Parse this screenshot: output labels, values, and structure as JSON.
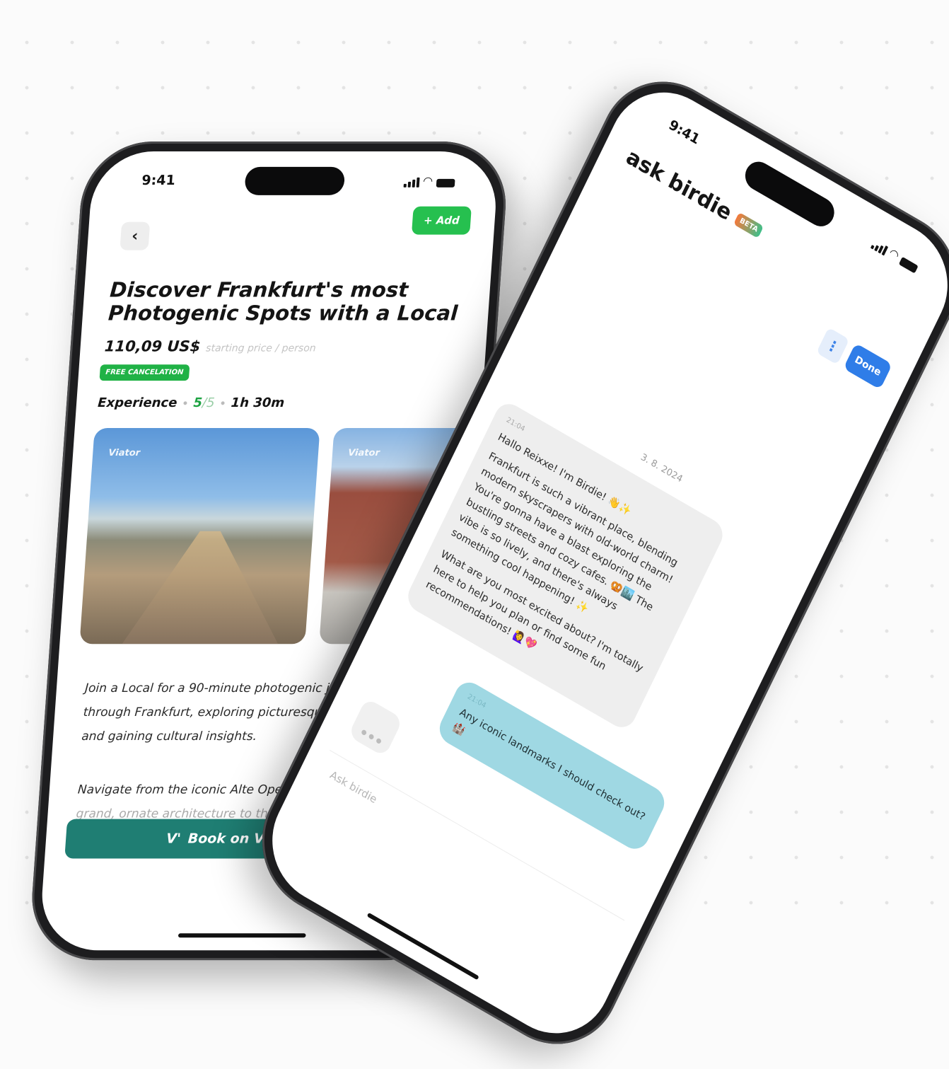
{
  "phone_left": {
    "status": {
      "time": "9:41"
    },
    "header": {
      "back_icon": "chevron-left-icon",
      "add_label": "+ Add"
    },
    "tour": {
      "title": "Discover Frankfurt's most Photogenic Spots with a Local",
      "price": "110,09 US$",
      "price_note": "starting price / person",
      "badge": "FREE CANCELATION",
      "type": "Experience",
      "rating": "5",
      "rating_max": "/5",
      "duration": "1h 30m",
      "photos": [
        {
          "source": "Viator"
        },
        {
          "source": "Viator"
        }
      ],
      "description_1": "Join a Local for a 90-minute photogenic journey through Frankfurt, exploring picturesque highlights and gaining cultural insights.",
      "description_2": "Navigate from the iconic Alte Oper capturing its",
      "description_2_fade": "grand, ornate architecture to the emblematic Iron"
    },
    "cta": {
      "label": "Book on Viator",
      "logo": "V'"
    },
    "colors": {
      "accent_green": "#26c04f",
      "cta_teal": "#1f7e73"
    }
  },
  "phone_right": {
    "status": {
      "time": "9:41"
    },
    "header": {
      "title": "ask birdie",
      "beta_label": "BETA",
      "menu_icon": "more-vertical-icon",
      "done_label": "Done"
    },
    "chat": {
      "date": "3. 8. 2024",
      "incoming": {
        "timestamp": "21:04",
        "greeting": "Hallo Reixxe! I'm Birdie! 👋✨",
        "paragraph_1": "Frankfurt is such a vibrant place, blending modern skyscrapers with old-world charm! You're gonna have a blast exploring the bustling streets and cozy cafes. 🥨🏙️ The vibe is so lively, and there's always something cool happening! ✨",
        "paragraph_2": "What are you most excited about? I'm totally here to help you plan or find some fun recommendations! 🙋‍♀️💖"
      },
      "outgoing": {
        "timestamp": "21:04",
        "text": "Any iconic landmarks I should check out? 🏰"
      }
    },
    "input": {
      "placeholder": "Ask birdie"
    },
    "colors": {
      "done_blue": "#2f7de8",
      "outgoing_bubble": "#9fd8e3"
    }
  }
}
